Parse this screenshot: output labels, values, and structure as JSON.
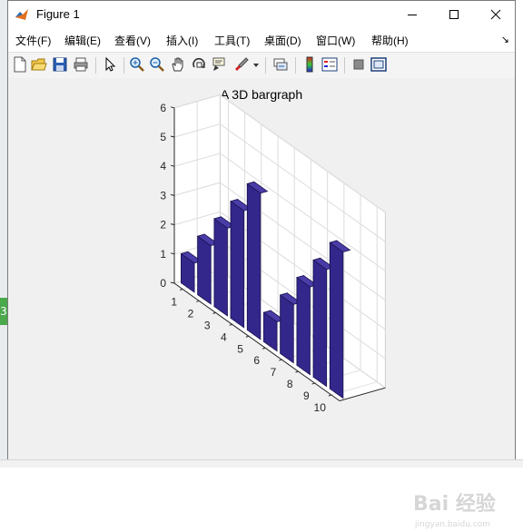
{
  "window": {
    "title": "Figure 1"
  },
  "menubar": {
    "items": [
      "文件(F)",
      "编辑(E)",
      "查看(V)",
      "插入(I)",
      "工具(T)",
      "桌面(D)",
      "窗口(W)",
      "帮助(H)"
    ]
  },
  "toolbar": {
    "icons": [
      "new-figure-icon",
      "open-file-icon",
      "save-icon",
      "print-icon",
      "select-arrow-icon",
      "zoom-in-icon",
      "zoom-out-icon",
      "pan-hand-icon",
      "rotate-3d-icon",
      "data-cursor-icon",
      "brush-icon",
      "brush-dropdown-icon",
      "link-plot-icon",
      "colorbar-icon",
      "legend-icon",
      "hide-plot-tools-icon",
      "show-plot-tools-icon"
    ]
  },
  "side_badge": "3",
  "watermark": {
    "text": "Bai 经验",
    "subtext": "jingyan.baidu.com"
  },
  "colors": {
    "bar_face": "#33278c",
    "bar_side": "#241b6a",
    "bar_top": "#4a3ca8"
  },
  "chart_data": {
    "type": "bar",
    "title": "A 3D bargraph",
    "categories": [
      "1",
      "2",
      "3",
      "4",
      "5",
      "6",
      "7",
      "8",
      "9",
      "10"
    ],
    "values": [
      1,
      2,
      3,
      4,
      5,
      1,
      2,
      3,
      4,
      5
    ],
    "ylim": [
      0,
      6
    ],
    "yticks": [
      "0",
      "1",
      "2",
      "3",
      "4",
      "5",
      "6"
    ],
    "xlabel": "",
    "ylabel": "",
    "grid": true,
    "projection": "3d"
  }
}
